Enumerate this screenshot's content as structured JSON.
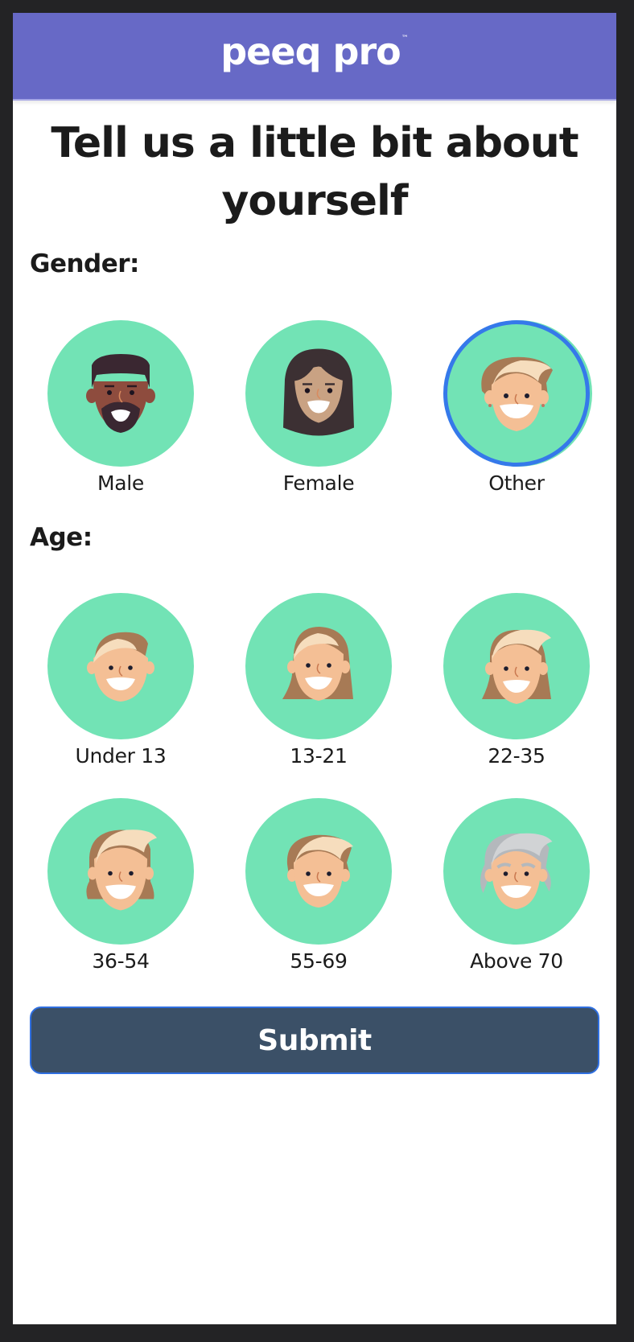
{
  "header": {
    "logo_text": "peeq pro",
    "logo_trademark": "™",
    "background_color": "#6769c6"
  },
  "title": "Tell us a little bit about yourself",
  "gender": {
    "label": "Gender:",
    "selected": "Other",
    "options": [
      {
        "label": "Male",
        "icon": "male-avatar-icon"
      },
      {
        "label": "Female",
        "icon": "female-avatar-icon"
      },
      {
        "label": "Other",
        "icon": "other-avatar-icon"
      }
    ]
  },
  "age": {
    "label": "Age:",
    "selected": null,
    "options": [
      {
        "label": "Under 13",
        "icon": "under-13-avatar-icon"
      },
      {
        "label": "13-21",
        "icon": "age-13-21-avatar-icon"
      },
      {
        "label": "22-35",
        "icon": "age-22-35-avatar-icon"
      },
      {
        "label": "36-54",
        "icon": "age-36-54-avatar-icon"
      },
      {
        "label": "55-69",
        "icon": "age-55-69-avatar-icon"
      },
      {
        "label": "Above 70",
        "icon": "above-70-avatar-icon"
      }
    ]
  },
  "submit": {
    "label": "Submit"
  },
  "colors": {
    "circle": "#72e3b5",
    "selected_ring": "#3579ea",
    "submit_bg": "#3b5067"
  }
}
